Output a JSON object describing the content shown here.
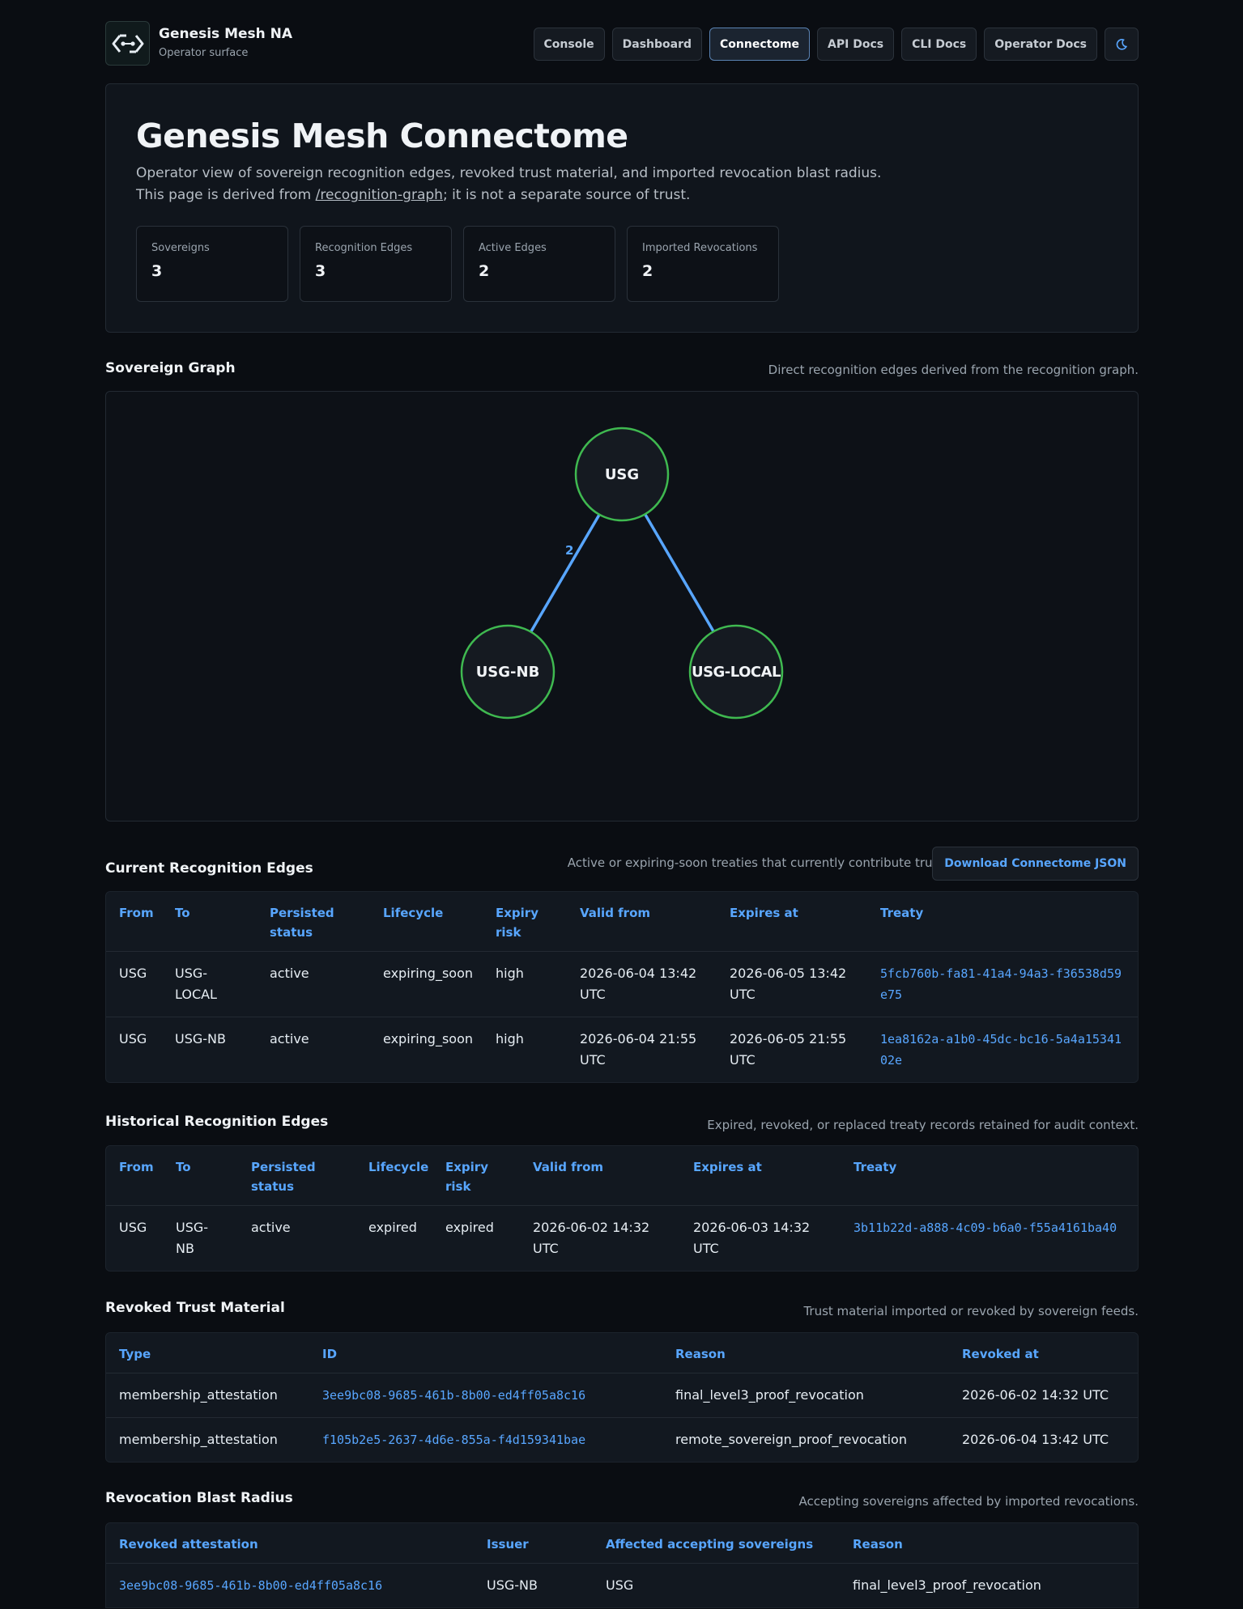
{
  "header": {
    "brand_title": "Genesis Mesh NA",
    "brand_subtitle": "Operator surface",
    "nav": [
      "Console",
      "Dashboard",
      "Connectome",
      "API Docs",
      "CLI Docs",
      "Operator Docs"
    ],
    "active_nav": "Connectome",
    "theme_icon": "moon-icon"
  },
  "hero": {
    "title": "Genesis Mesh Connectome",
    "desc_line1": "Operator view of sovereign recognition edges, revoked trust material, and imported revocation blast radius.",
    "desc_line2_prefix": "This page is derived from ",
    "desc_line2_link": "/recognition-graph",
    "desc_line2_suffix": "; it is not a separate source of trust.",
    "stats": [
      {
        "label": "Sovereigns",
        "value": "3"
      },
      {
        "label": "Recognition Edges",
        "value": "3"
      },
      {
        "label": "Active Edges",
        "value": "2"
      },
      {
        "label": "Imported Revocations",
        "value": "2"
      }
    ]
  },
  "graph_section": {
    "title": "Sovereign Graph",
    "note": "Direct recognition edges derived from the recognition graph.",
    "nodes": [
      "USG",
      "USG-NB",
      "USG-LOCAL"
    ],
    "edge_label": "2",
    "node_color": "#3fb950",
    "edge_color": "#58a6ff"
  },
  "current_edges": {
    "title": "Current Recognition Edges",
    "note": "Active or expiring-soon treaties that currently contribute trust.",
    "download_label": "Download Connectome JSON",
    "columns": [
      "From",
      "To",
      "Persisted status",
      "Lifecycle",
      "Expiry risk",
      "Valid from",
      "Expires at",
      "Treaty"
    ],
    "rows": [
      [
        "USG",
        "USG-LOCAL",
        "active",
        "expiring_soon",
        "high",
        "2026-06-04 13:42 UTC",
        "2026-06-05 13:42 UTC",
        "5fcb760b-fa81-41a4-94a3-f36538d59e75"
      ],
      [
        "USG",
        "USG-NB",
        "active",
        "expiring_soon",
        "high",
        "2026-06-04 21:55 UTC",
        "2026-06-05 21:55 UTC",
        "1ea8162a-a1b0-45dc-bc16-5a4a1534102e"
      ]
    ]
  },
  "historical_edges": {
    "title": "Historical Recognition Edges",
    "note": "Expired, revoked, or replaced treaty records retained for audit context.",
    "columns": [
      "From",
      "To",
      "Persisted status",
      "Lifecycle",
      "Expiry risk",
      "Valid from",
      "Expires at",
      "Treaty"
    ],
    "rows": [
      [
        "USG",
        "USG-NB",
        "active",
        "expired",
        "expired",
        "2026-06-02 14:32 UTC",
        "2026-06-03 14:32 UTC",
        "3b11b22d-a888-4c09-b6a0-f55a4161ba40"
      ]
    ]
  },
  "revoked": {
    "title": "Revoked Trust Material",
    "note": "Trust material imported or revoked by sovereign feeds.",
    "columns": [
      "Type",
      "ID",
      "Reason",
      "Revoked at"
    ],
    "rows": [
      [
        "membership_attestation",
        "3ee9bc08-9685-461b-8b00-ed4ff05a8c16",
        "final_level3_proof_revocation",
        "2026-06-02 14:32 UTC"
      ],
      [
        "membership_attestation",
        "f105b2e5-2637-4d6e-855a-f4d159341bae",
        "remote_sovereign_proof_revocation",
        "2026-06-04 13:42 UTC"
      ]
    ]
  },
  "blast": {
    "title": "Revocation Blast Radius",
    "note": "Accepting sovereigns affected by imported revocations.",
    "columns": [
      "Revoked attestation",
      "Issuer",
      "Affected accepting sovereigns",
      "Reason"
    ],
    "rows": [
      [
        "3ee9bc08-9685-461b-8b00-ed4ff05a8c16",
        "USG-NB",
        "USG",
        "final_level3_proof_revocation"
      ]
    ]
  }
}
